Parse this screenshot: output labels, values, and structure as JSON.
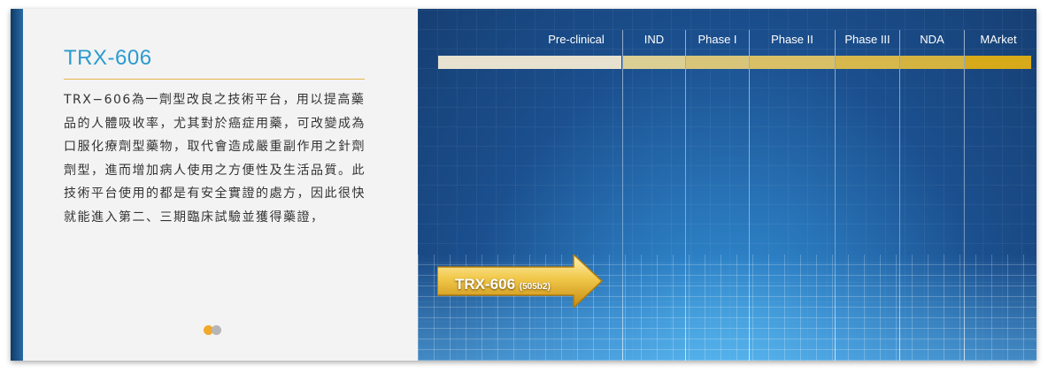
{
  "product": {
    "title": "TRX-606",
    "description": "TRX−606為一劑型改良之技術平台，用以提高藥品的人體吸收率，尤其對於癌症用藥，可改變成為口服化療劑型藥物，取代會造成嚴重副作用之針劑劑型，進而增加病人使用之方便性及生活品質。此技術平台使用的都是有安全實證的處方，因此很快就能進入第二、三期臨床試驗並獲得藥證，"
  },
  "pipeline": {
    "phases": [
      "Pre-clinical",
      "IND",
      "Phase I",
      "Phase II",
      "Phase III",
      "NDA",
      "MArket"
    ],
    "bar_colors": [
      "#e6e2cf",
      "#dccf94",
      "#d9c57a",
      "#d9c066",
      "#d6b84c",
      "#d4b340",
      "#d6aa18"
    ],
    "drug": {
      "name": "TRX-606",
      "code": "(505b2)",
      "current_phase": "Pre-clinical"
    }
  },
  "carousel": {
    "slide_count": 2,
    "active_index": 0,
    "colors": {
      "active": "#f0a92a",
      "inactive": "#b5b5b5"
    }
  },
  "colors": {
    "title": "#2b9bd0",
    "rule": "#e3b54a",
    "background_blue": "#1b4f8e"
  }
}
